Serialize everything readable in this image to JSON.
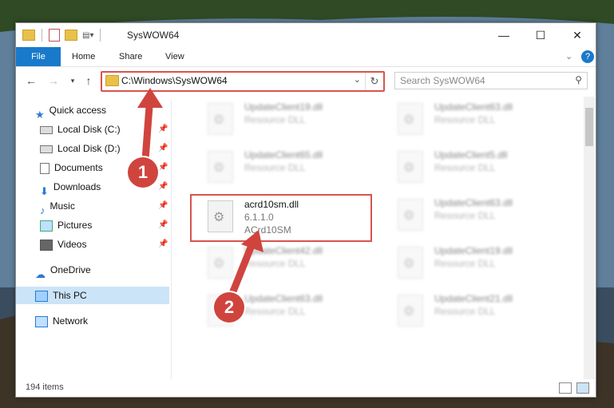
{
  "window": {
    "title": "SysWOW64",
    "controls": {
      "minimize": "—",
      "maximize": "☐",
      "close": "✕"
    }
  },
  "ribbon": {
    "tabs": [
      {
        "label": "File"
      },
      {
        "label": "Home"
      },
      {
        "label": "Share"
      },
      {
        "label": "View"
      }
    ],
    "expand_icon": "chevron-down-icon",
    "help_icon": "help-icon"
  },
  "address": {
    "path": "C:\\Windows\\SysWOW64",
    "dropdown_glyph": "⌄",
    "refresh_glyph": "↻"
  },
  "search": {
    "placeholder": "Search SysWOW64",
    "icon": "search-icon"
  },
  "nav": {
    "quick_access": "Quick access",
    "items": [
      {
        "label": "Local Disk (C:)",
        "icon": "drive-icon",
        "pinned": true
      },
      {
        "label": "Local Disk (D:)",
        "icon": "drive-icon",
        "pinned": true
      },
      {
        "label": "Documents",
        "icon": "documents-icon",
        "pinned": true
      },
      {
        "label": "Downloads",
        "icon": "downloads-icon",
        "pinned": true
      },
      {
        "label": "Music",
        "icon": "music-icon",
        "pinned": true
      },
      {
        "label": "Pictures",
        "icon": "pictures-icon",
        "pinned": true
      },
      {
        "label": "Videos",
        "icon": "videos-icon",
        "pinned": true
      }
    ],
    "onedrive": "OneDrive",
    "this_pc": "This PC",
    "network": "Network"
  },
  "files": [
    {
      "name": "UpdateClient19.dll",
      "sub": "Resource DLL",
      "blurred": true
    },
    {
      "name": "UpdateClient63.dll",
      "sub": "Resource DLL",
      "blurred": true
    },
    {
      "name": "UpdateClient65.dll",
      "sub": "Resource DLL",
      "blurred": true
    },
    {
      "name": "UpdateClient5.dll",
      "sub": "Resource DLL",
      "blurred": true
    },
    {
      "name": "acrd10sm.dll",
      "sub": "6.1.1.0",
      "sub2": "ACrd10SM",
      "blurred": false
    },
    {
      "name": "UpdateClient63.dll",
      "sub": "Resource DLL",
      "blurred": true
    },
    {
      "name": "UpdateClient42.dll",
      "sub": "Resource DLL",
      "blurred": true
    },
    {
      "name": "UpdateClient19.dll",
      "sub": "Resource DLL",
      "blurred": true
    },
    {
      "name": "UpdateClient63.dll",
      "sub": "Resource DLL",
      "blurred": true
    },
    {
      "name": "UpdateClient21.dll",
      "sub": "Resource DLL",
      "blurred": true
    }
  ],
  "status": {
    "count": "194 items"
  },
  "callouts": {
    "one": "1",
    "two": "2"
  },
  "colors": {
    "accent": "#1979ca",
    "highlight": "#d9534f",
    "selected": "#cce4f7"
  }
}
